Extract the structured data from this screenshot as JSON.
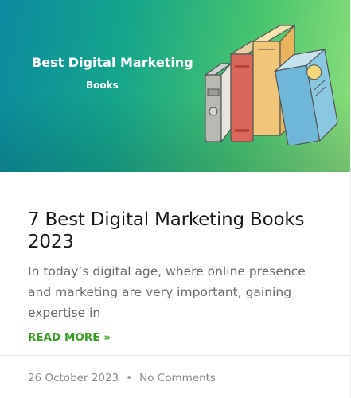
{
  "banner": {
    "title": "Best Digital Marketing",
    "subtitle": "Books",
    "gradient_start": "#0b8aa0",
    "gradient_end": "#8fe07a",
    "illustration": "books-illustration"
  },
  "post": {
    "title": "7 Best Digital Marketing Books 2023",
    "excerpt": "In today’s digital age, where online presence and marketing are very important, gaining expertise in",
    "read_more_label": "READ MORE »",
    "read_more_color": "#3a9d23"
  },
  "meta": {
    "date": "26 October 2023",
    "separator": "•",
    "comments": "No Comments"
  }
}
